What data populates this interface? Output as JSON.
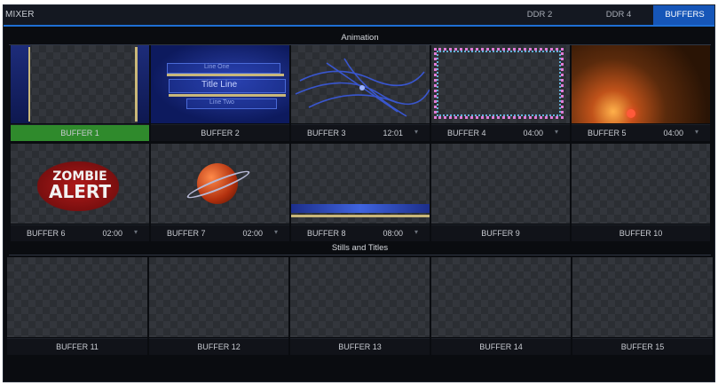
{
  "app": {
    "title": "MIXER",
    "tabs": [
      {
        "label": "DDR 2",
        "active": false
      },
      {
        "label": "DDR 4",
        "active": false
      },
      {
        "label": "BUFFERS",
        "active": true
      }
    ],
    "accent_color": "#1f6fd4",
    "active_label_color": "#2f8a2c"
  },
  "sections": {
    "animation": "Animation",
    "stills": "Stills and Titles"
  },
  "buffers": [
    {
      "label": "BUFFER 1",
      "time": "",
      "active": true
    },
    {
      "label": "BUFFER 2",
      "time": "",
      "active": false,
      "content_text": "Title Line",
      "content_small": "Line One",
      "content_small2": "Line Two"
    },
    {
      "label": "BUFFER 3",
      "time": "12:01",
      "active": false
    },
    {
      "label": "BUFFER 4",
      "time": "04:00",
      "active": false
    },
    {
      "label": "BUFFER 5",
      "time": "04:00",
      "active": false
    },
    {
      "label": "BUFFER 6",
      "time": "02:00",
      "active": false,
      "content_text": "ZOMBIE",
      "content_text2": "ALERT"
    },
    {
      "label": "BUFFER 7",
      "time": "02:00",
      "active": false
    },
    {
      "label": "BUFFER 8",
      "time": "08:00",
      "active": false
    },
    {
      "label": "BUFFER 9",
      "time": "",
      "active": false
    },
    {
      "label": "BUFFER 10",
      "time": "",
      "active": false
    },
    {
      "label": "BUFFER 11",
      "time": "",
      "active": false
    },
    {
      "label": "BUFFER 12",
      "time": "",
      "active": false
    },
    {
      "label": "BUFFER 13",
      "time": "",
      "active": false
    },
    {
      "label": "BUFFER 14",
      "time": "",
      "active": false
    },
    {
      "label": "BUFFER 15",
      "time": "",
      "active": false
    }
  ]
}
